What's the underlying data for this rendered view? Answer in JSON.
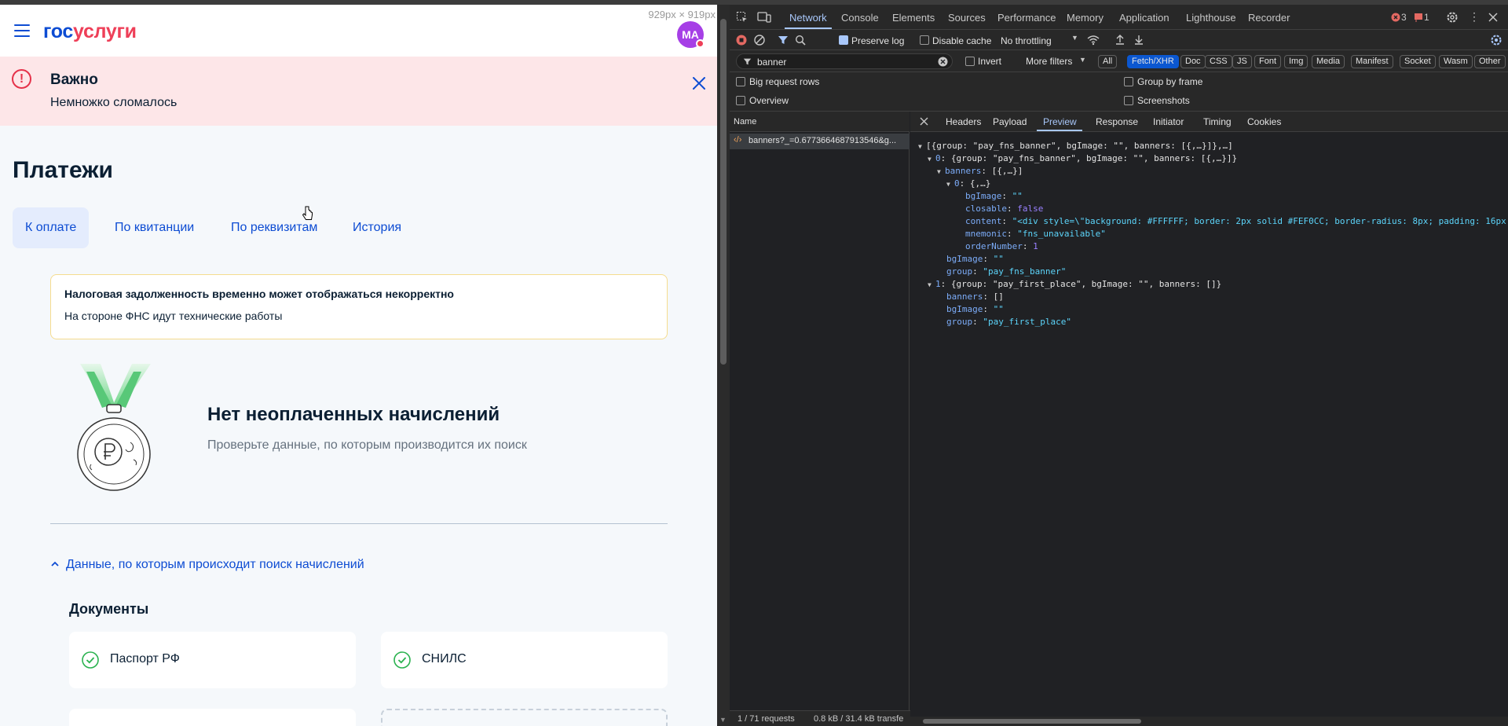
{
  "viewport_size": "929px × 919px",
  "site": {
    "logo_blue": "гос",
    "logo_red": "услуги",
    "avatar_initials": "MA",
    "alert": {
      "title": "Важно",
      "text": "Немножко сломалось"
    },
    "page_title": "Платежи",
    "tabs": [
      {
        "label": "К оплате",
        "active": true
      },
      {
        "label": "По квитанции"
      },
      {
        "label": "По реквизитам"
      },
      {
        "label": "История"
      }
    ],
    "notice": {
      "title": "Налоговая задолженность временно может отображаться некорректно",
      "text": "На стороне ФНС идут технические работы"
    },
    "empty": {
      "title": "Нет неоплаченных начислений",
      "text": "Проверьте данные, по которым производится их поиск"
    },
    "search_toggle": "Данные, по которым происходит поиск начислений",
    "documents_title": "Документы",
    "documents": [
      "Паспорт РФ",
      "СНИЛС"
    ],
    "colors": {
      "brand_blue": "#0d4cd3",
      "brand_red": "#ee3f58",
      "alert_bg": "#fde6e8"
    }
  },
  "devtools": {
    "tabs": [
      "Network",
      "Console",
      "Elements",
      "Sources",
      "Performance",
      "Memory",
      "Application",
      "Lighthouse",
      "Recorder"
    ],
    "active_tab": "Network",
    "errors_count": "3",
    "warnings_count": "1",
    "toolbar": {
      "preserve_log": "Preserve log",
      "disable_cache": "Disable cache",
      "throttling": "No throttling"
    },
    "filter": {
      "value": "banner",
      "invert": "Invert",
      "more_filters": "More filters",
      "types": [
        "All",
        "Fetch/XHR",
        "Doc",
        "CSS",
        "JS",
        "Font",
        "Img",
        "Media",
        "Manifest",
        "Socket",
        "Wasm",
        "Other"
      ],
      "active_type": "Fetch/XHR"
    },
    "options": {
      "big_request_rows": "Big request rows",
      "group_by_frame": "Group by frame",
      "overview": "Overview",
      "screenshots": "Screenshots"
    },
    "name_header": "Name",
    "request_name": "banners?_=0.6773664687913546&g...",
    "detail_tabs": [
      "Headers",
      "Payload",
      "Preview",
      "Response",
      "Initiator",
      "Timing",
      "Cookies"
    ],
    "active_detail_tab": "Preview",
    "status": {
      "requests": "1 / 71 requests",
      "transferred": "0.8 kB / 31.4 kB transfe"
    },
    "preview_lines": {
      "l1": "[{group: \"pay_fns_banner\", bgImage: \"\", banners: [{,…}]},…]",
      "l2_key": "0",
      "l2_val": "{group: \"pay_fns_banner\", bgImage: \"\", banners: [{,…}]}",
      "l3_key": "banners",
      "l3_val": "[{,…}]",
      "l4_key": "0",
      "l4_val": "{,…}",
      "bgImage_key": "bgImage",
      "empty_str": "\"\"",
      "closable_key": "closable",
      "closable_val": "false",
      "content_key": "content",
      "content_val": "\"<div style=\\\"background: #FFFFFF; border: 2px solid #FEF0CC; border-radius: 8px; padding: 16px;",
      "mnemonic_key": "mnemonic",
      "mnemonic_val": "\"fns_unavailable\"",
      "order_key": "orderNumber",
      "order_val": "1",
      "group_key": "group",
      "group_val_0": "\"pay_fns_banner\"",
      "l_1_key": "1",
      "l_1_val": "{group: \"pay_first_place\", bgImage: \"\", banners: []}",
      "banners_empty": "[]",
      "group_val_1": "\"pay_first_place\""
    }
  }
}
